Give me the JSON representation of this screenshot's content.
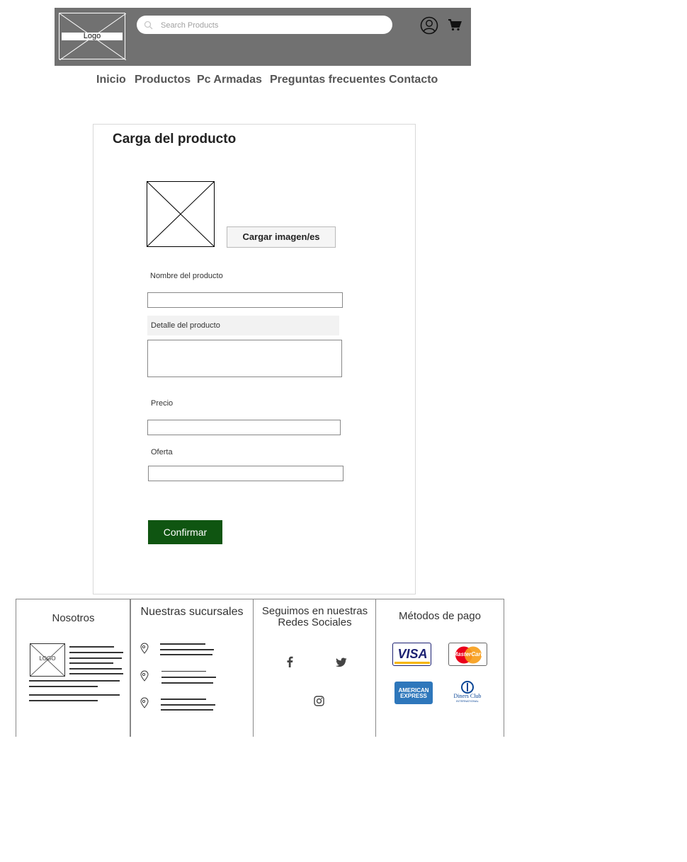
{
  "header": {
    "logo_text": "Logo",
    "search_placeholder": "Search Products",
    "header_color": "#717171"
  },
  "nav": {
    "items": [
      "Inicio",
      "Productos",
      "Pc Armadas",
      "Preguntas frecuentes",
      "Contacto"
    ]
  },
  "form": {
    "title": "Carga del producto",
    "upload_button": "Cargar imagen/es",
    "name_label": "Nombre del producto",
    "name_value": "",
    "detail_label": "Detalle del producto",
    "detail_value": "",
    "price_label": "Precio",
    "price_value": "",
    "offer_label": "Oferta",
    "offer_value": "",
    "confirm_button": "Confirmar",
    "confirm_color": "#0f5511"
  },
  "footer": {
    "about_title": "Nosotros",
    "about_logo_text": "LOGO",
    "branches_title": "Nuestras sucursales",
    "social_title": "Seguimos en nuestras Redes Sociales",
    "social_icons": [
      "facebook-icon",
      "twitter-icon",
      "instagram-icon"
    ],
    "payments_title": "Métodos de pago",
    "payment_cards": [
      "VISA",
      "MasterCard",
      "AMERICAN EXPRESS",
      "Diners Club"
    ],
    "payment_sub": "INTERNATIONAL"
  }
}
